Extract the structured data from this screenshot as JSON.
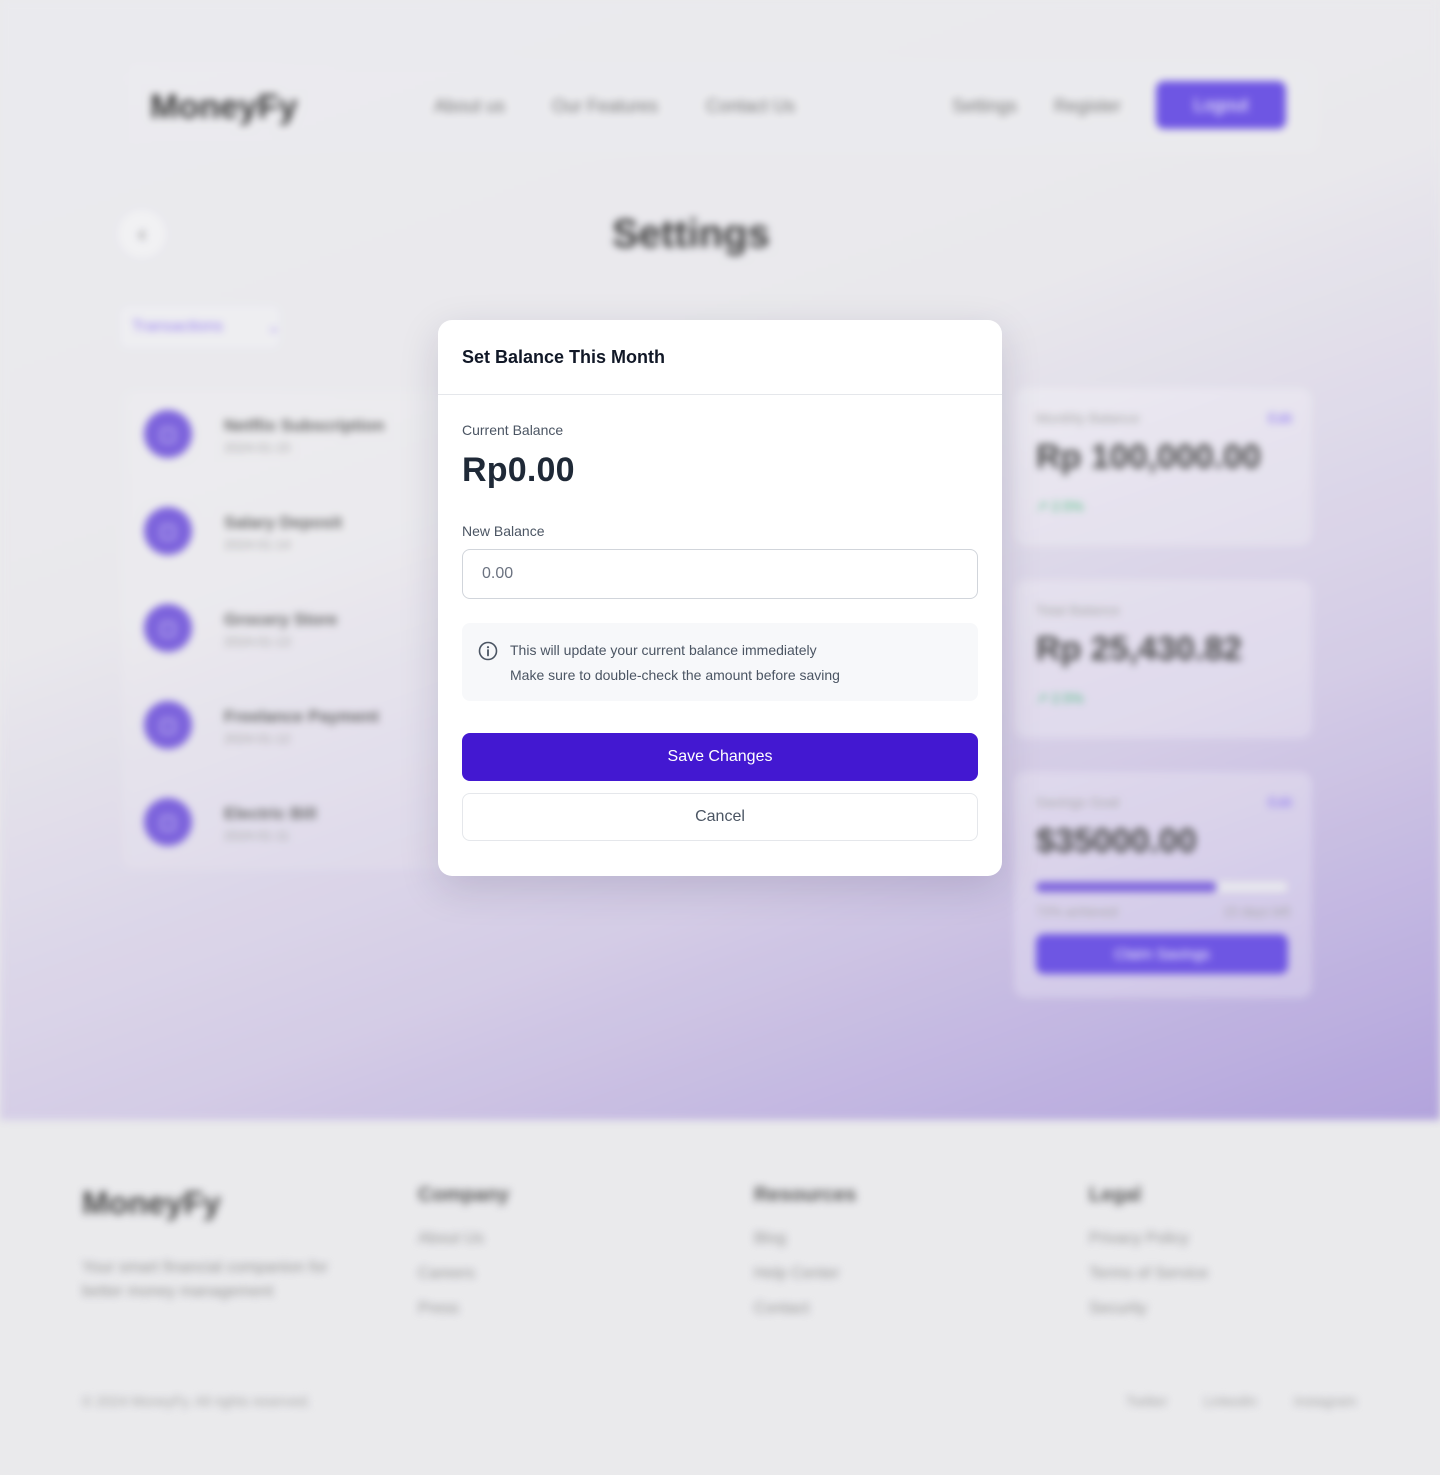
{
  "colors": {
    "accent": "#4318d1",
    "brand_purple": "#5b3fe0",
    "trend_green": "#2fb36b"
  },
  "background": {
    "nav": {
      "brand": "MoneyFy",
      "links": [
        "About us",
        "Our Features",
        "Contact Us"
      ],
      "right_links": [
        "Settings",
        "Register"
      ],
      "logout_label": "Logout"
    },
    "page": {
      "back_icon": "chevron-left-icon",
      "title": "Settings",
      "filter_label": "Transactions",
      "filter_icon": "chevron-down-icon"
    },
    "transactions": [
      {
        "name": "Netflix Subscription",
        "date": "2024-01-15"
      },
      {
        "name": "Salary Deposit",
        "date": "2024-01-14"
      },
      {
        "name": "Grocery Store",
        "date": "2024-01-13"
      },
      {
        "name": "Freelance Payment",
        "date": "2024-01-12"
      },
      {
        "name": "Electric Bill",
        "date": "2024-01-11"
      }
    ],
    "cards": {
      "monthly": {
        "label": "Monthly Balance",
        "edit": "Edit",
        "value": "Rp 100,000.00",
        "trend": "2.5%"
      },
      "total": {
        "label": "Total Balance",
        "value": "Rp 25,430.82",
        "trend": "2.5%"
      },
      "savings": {
        "label": "Savings Goal",
        "edit": "Edit",
        "value": "$35000.00",
        "progress": 0.72,
        "progress_text": "72% achieved",
        "days_left": "15 days left",
        "claim_label": "Claim Savings"
      }
    },
    "footer": {
      "brand": "MoneyFy",
      "description": "Your smart financial companion for better money management",
      "columns": [
        {
          "title": "Company",
          "links": [
            "About Us",
            "Careers",
            "Press"
          ]
        },
        {
          "title": "Resources",
          "links": [
            "Blog",
            "Help Center",
            "Contact"
          ]
        },
        {
          "title": "Legal",
          "links": [
            "Privacy Policy",
            "Terms of Service",
            "Security"
          ]
        }
      ],
      "copyright": "© 2024 MoneyFy. All rights reserved.",
      "social": [
        "Twitter",
        "LinkedIn",
        "Instagram"
      ]
    }
  },
  "modal": {
    "title": "Set Balance This Month",
    "current_balance_label": "Current Balance",
    "current_balance_value": "Rp0.00",
    "new_balance_label": "New Balance",
    "new_balance_value": "",
    "new_balance_placeholder": "0.00",
    "info_icon": "info-icon",
    "info_line1": "This will update your current balance immediately",
    "info_line2": "Make sure to double-check the amount before saving",
    "save_label": "Save Changes",
    "cancel_label": "Cancel"
  }
}
